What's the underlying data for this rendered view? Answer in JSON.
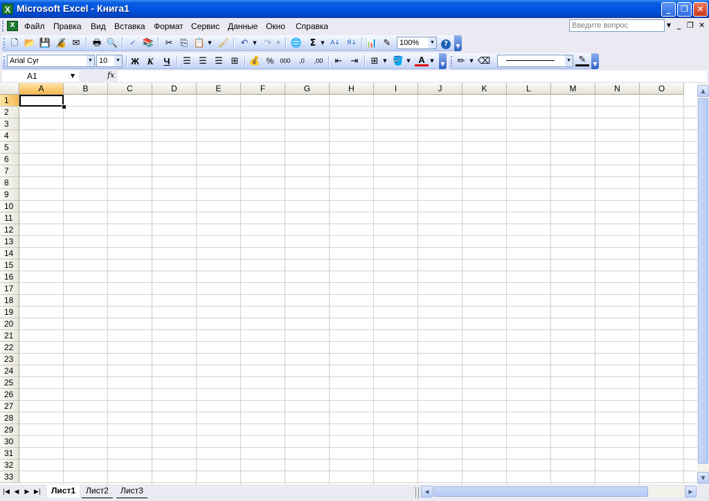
{
  "window": {
    "title": "Microsoft Excel - Книга1",
    "app_icon_glyph": "X",
    "minimize_glyph": "_",
    "restore_glyph": "❐",
    "close_glyph": "✕"
  },
  "menu": {
    "items": [
      "Файл",
      "Правка",
      "Вид",
      "Вставка",
      "Формат",
      "Сервис",
      "Данные",
      "Окно",
      "Справка"
    ],
    "help_placeholder": "Введите вопрос",
    "doc_minimize": "_",
    "doc_restore": "❐",
    "doc_close": "✕"
  },
  "standard_toolbar": {
    "zoom": "100%",
    "sum_glyph": "Σ"
  },
  "formatting_toolbar": {
    "font_name": "Arial Cyr",
    "font_size": "10",
    "bold": "Ж",
    "italic": "К",
    "underline": "Ч",
    "percent": "%",
    "thousands": "000",
    "inc_decimal": ",0",
    "dec_decimal": ",00",
    "font_color_glyph": "A"
  },
  "formula_bar": {
    "name_box": "A1",
    "fx": "fx",
    "formula": ""
  },
  "grid": {
    "columns": [
      "A",
      "B",
      "C",
      "D",
      "E",
      "F",
      "G",
      "H",
      "I",
      "J",
      "K",
      "L",
      "M",
      "N",
      "O"
    ],
    "rows": [
      "1",
      "2",
      "3",
      "4",
      "5",
      "6",
      "7",
      "8",
      "9",
      "10",
      "11",
      "12",
      "13",
      "14",
      "15",
      "16",
      "17",
      "18",
      "19",
      "20",
      "21",
      "22",
      "23",
      "24",
      "25",
      "26",
      "27",
      "28",
      "29",
      "30",
      "31",
      "32",
      "33"
    ],
    "active_cell": "A1"
  },
  "sheets": {
    "tabs": [
      "Лист1",
      "Лист2",
      "Лист3"
    ],
    "active": "Лист1"
  },
  "colors": {
    "titlebar": "#0054e3",
    "toolbar": "#dbe5fa",
    "selected_header": "#f6b84e",
    "gridline": "#d4d0c8"
  }
}
